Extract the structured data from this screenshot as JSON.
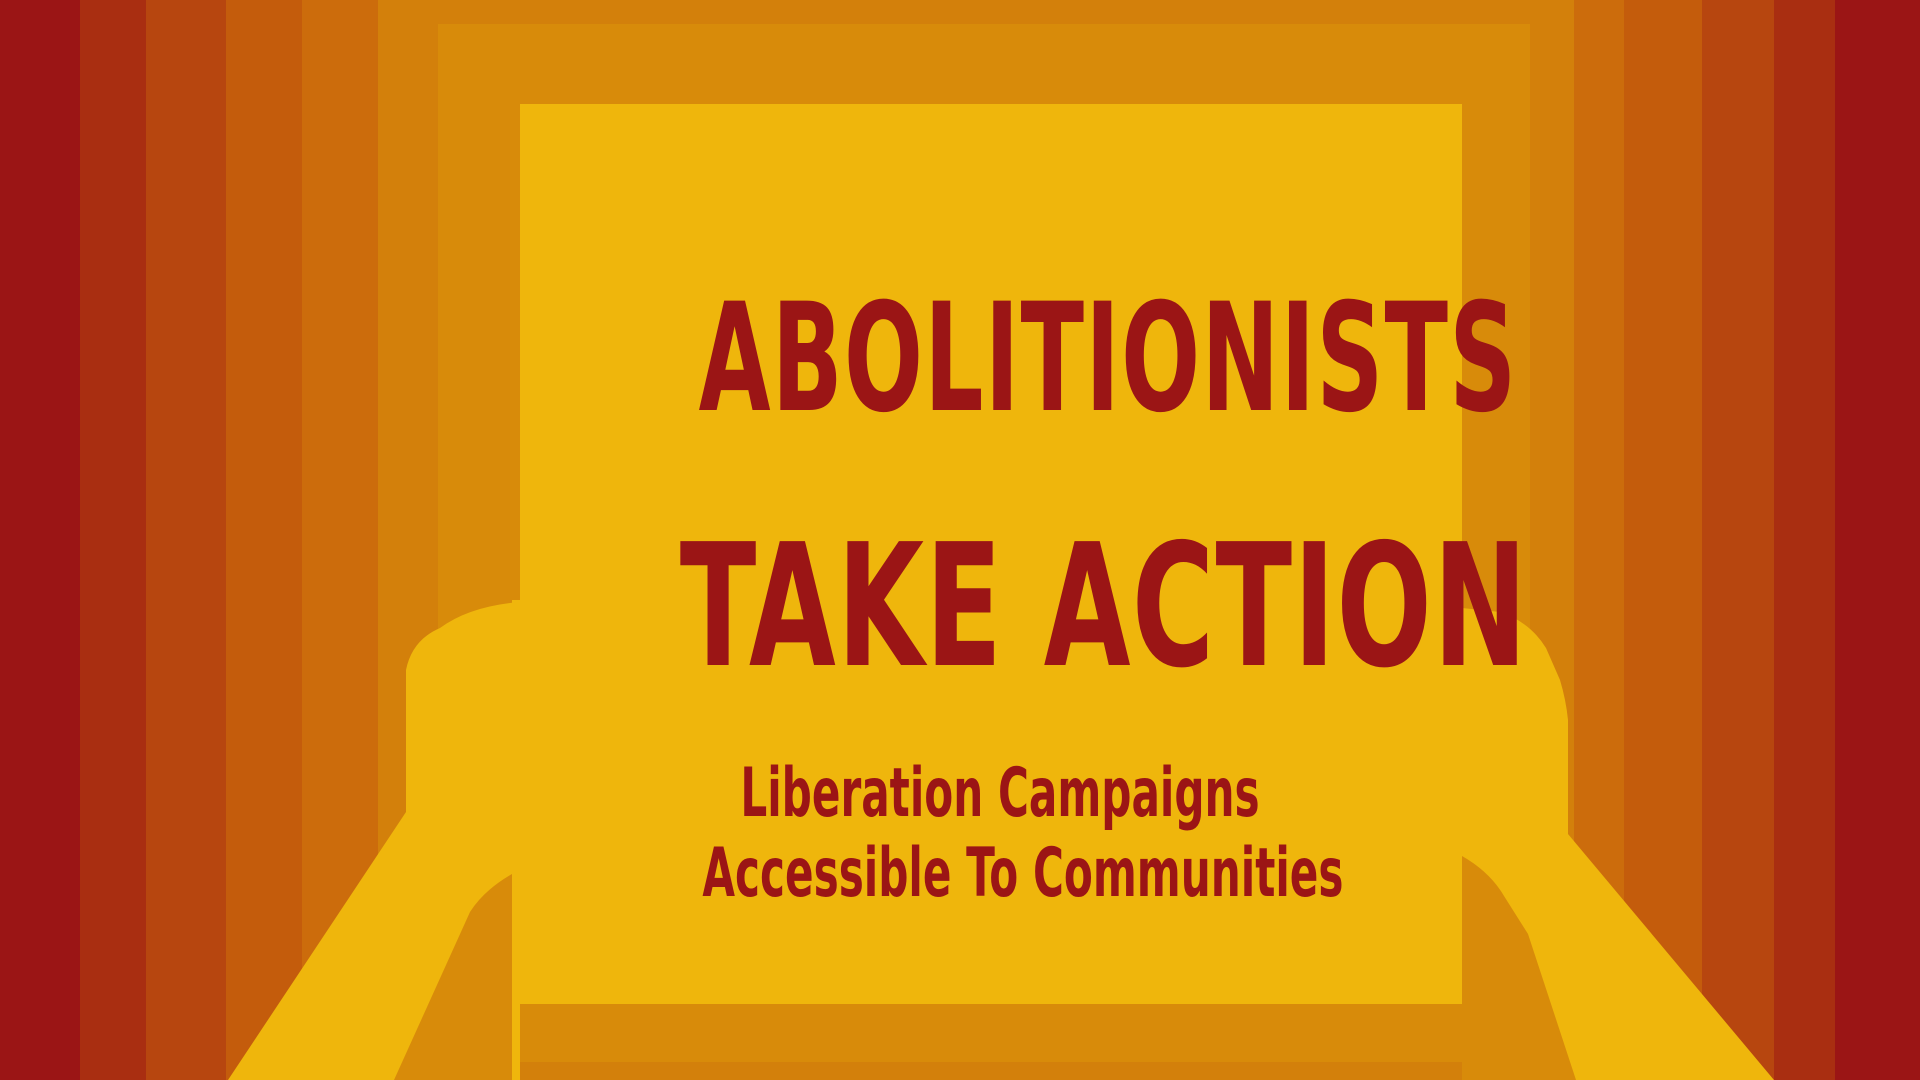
{
  "poster": {
    "title_line1": "ABOLITIONISTS",
    "title_line2": "TAKE ACTION",
    "subtitle_line1": "Liberation Campaigns",
    "subtitle_line2": "Accessible To Communities"
  },
  "colors": {
    "deep_red": "#9b1515",
    "sign_yellow": "#efb60c",
    "stripe_1": "#a92e11",
    "stripe_2": "#b7460f",
    "stripe_3": "#c45c0c",
    "stripe_4": "#cc6c0c",
    "stripe_5": "#d3800b",
    "stripe_6": "#d88b0a"
  }
}
